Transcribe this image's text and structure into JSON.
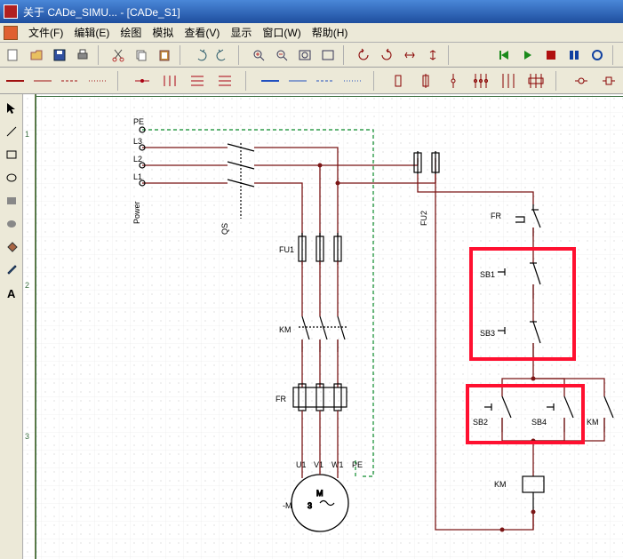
{
  "title": "关于 CADe_SIMU... - [CADe_S1]",
  "menu": {
    "file": "文件(F)",
    "edit": "编辑(E)",
    "draw": "绘图",
    "sim": "模拟",
    "view": "查看(V)",
    "display": "显示",
    "window": "窗口(W)",
    "help": "帮助(H)"
  },
  "ruler": {
    "t1": "1",
    "t2": "2",
    "t3": "3"
  },
  "labels": {
    "PE": "PE",
    "L3": "L3",
    "L2": "L2",
    "L1": "L1",
    "Power": "Power",
    "QS": "QS",
    "FU1": "FU1",
    "FU2": "FU2",
    "FR": "FR",
    "KM": "KM",
    "KM2": "KM",
    "KM3": "KM",
    "SB1": "SB1",
    "SB2": "SB2",
    "SB3": "SB3",
    "SB4": "SB4",
    "U1": "U1",
    "V1": "V1",
    "W1": "W1",
    "PE2": "PE",
    "Mneg": "-M",
    "M": "M",
    "M3": "3",
    "tilde": "~"
  }
}
